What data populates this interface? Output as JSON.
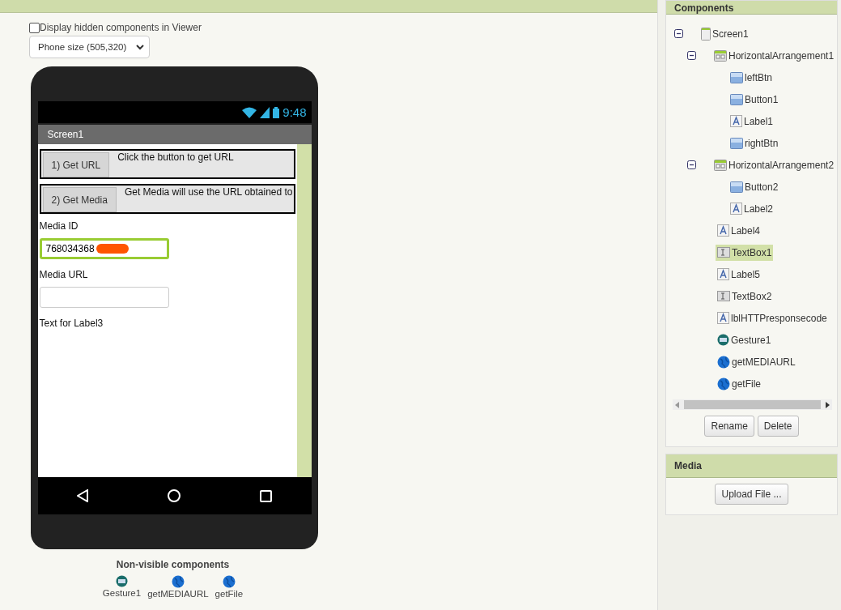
{
  "viewer": {
    "hidden_checkbox": {
      "label": "Display hidden components in Viewer",
      "checked": false
    },
    "phone_size": {
      "value": "Phone size (505,320)"
    },
    "phone": {
      "time": "9:48",
      "screen_title": "Screen1",
      "arrangements": [
        {
          "button": "1) Get URL",
          "text": "Click the button to get URL"
        },
        {
          "button": "2) Get Media",
          "text": "Get Media will use the URL obtained to"
        }
      ],
      "media_id_label": "Media ID",
      "media_id_value": "768034368",
      "media_id_focused": true,
      "media_url_label": "Media URL",
      "label3": "Text for Label3"
    },
    "nonvisible_title": "Non-visible components",
    "nonvisible": [
      {
        "kind": "gesture",
        "label": "Gesture1"
      },
      {
        "kind": "web",
        "label": "getMEDIAURL"
      },
      {
        "kind": "web",
        "label": "getFile"
      }
    ]
  },
  "components": {
    "title": "Components",
    "tree": [
      {
        "kind": "screen",
        "label": "Screen1",
        "expanded": true,
        "selected": false,
        "children": [
          {
            "kind": "arrangement",
            "label": "HorizontalArrangement1",
            "expanded": true,
            "selected": false,
            "children": [
              {
                "kind": "button",
                "label": "leftBtn",
                "selected": false
              },
              {
                "kind": "button",
                "label": "Button1",
                "selected": false
              },
              {
                "kind": "label",
                "label": "Label1",
                "selected": false
              },
              {
                "kind": "button",
                "label": "rightBtn",
                "selected": false
              }
            ]
          },
          {
            "kind": "arrangement",
            "label": "HorizontalArrangement2",
            "expanded": true,
            "selected": false,
            "children": [
              {
                "kind": "button",
                "label": "Button2",
                "selected": false
              },
              {
                "kind": "label",
                "label": "Label2",
                "selected": false
              }
            ]
          },
          {
            "kind": "label",
            "label": "Label4",
            "selected": false
          },
          {
            "kind": "textbox",
            "label": "TextBox1",
            "selected": true
          },
          {
            "kind": "label",
            "label": "Label5",
            "selected": false
          },
          {
            "kind": "textbox",
            "label": "TextBox2",
            "selected": false
          },
          {
            "kind": "label",
            "label": "lblHTTPresponsecode",
            "selected": false
          },
          {
            "kind": "gesture",
            "label": "Gesture1",
            "selected": false
          },
          {
            "kind": "web",
            "label": "getMEDIAURL",
            "selected": false
          },
          {
            "kind": "web",
            "label": "getFile",
            "selected": false
          }
        ]
      }
    ],
    "buttons": [
      "Rename",
      "Delete"
    ]
  },
  "media": {
    "title": "Media",
    "button": "Upload File ..."
  }
}
